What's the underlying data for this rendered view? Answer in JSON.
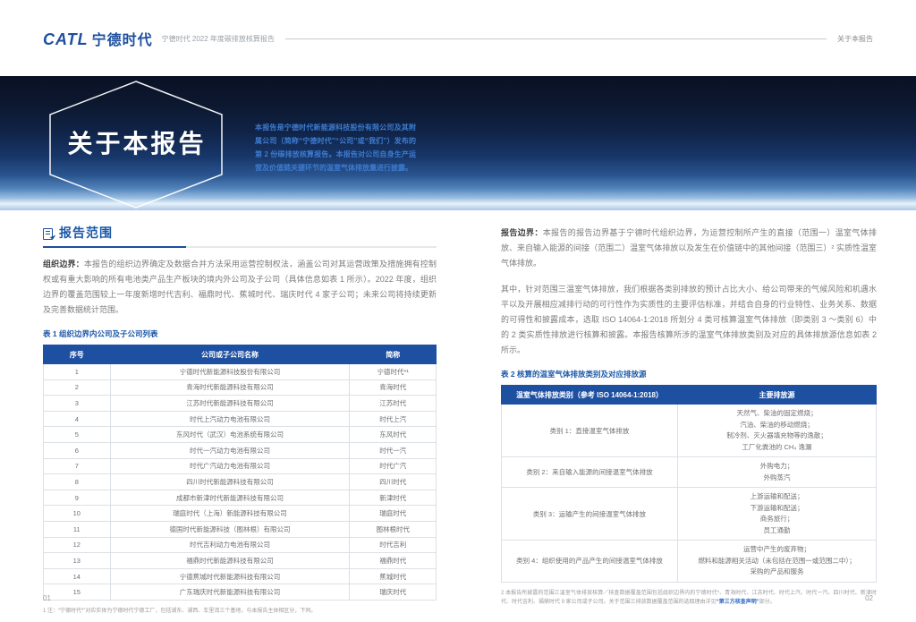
{
  "header": {
    "logo_latin": "CATL",
    "logo_cn": "宁德时代",
    "subtitle": "宁德时代 2022 年度碳排放核算报告",
    "right_label": "关于本报告"
  },
  "hero": {
    "hex_title": "关于本报告",
    "intro": "本报告是宁德时代新能源科技股份有限公司及其附属公司（简称“宁德时代”“公司”或“我们”）发布的第 2 份碳排放核算报告。本报告对公司自身生产运营及价值链关键环节的温室气体排放量进行披露。"
  },
  "left": {
    "section_title": "报告范围",
    "p1_lead": "组织边界：",
    "p1": "本报告的组织边界确定及数据合并方法采用运营控制权法，涵盖公司对其运营政策及措施拥有控制权或有重大影响的所有电池类产品生产板块的境内外公司及子公司（具体信息如表 1 所示）。2022 年度，组织边界的覆盖范围较上一年度新增时代吉利、福鼎时代、蕉城时代、瑞庆时代 4 家子公司；未来公司将持续更新及完善数据统计范围。",
    "table1": {
      "caption": "表 1 组织边界内公司及子公司列表",
      "headers": [
        "序号",
        "公司或子公司名称",
        "简称"
      ],
      "rows": [
        [
          "1",
          "宁德时代新能源科技股份有限公司",
          "宁德时代*¹"
        ],
        [
          "2",
          "青海时代新能源科技有限公司",
          "青海时代"
        ],
        [
          "3",
          "江苏时代新能源科技有限公司",
          "江苏时代"
        ],
        [
          "4",
          "时代上汽动力电池有限公司",
          "时代上汽"
        ],
        [
          "5",
          "东风时代（武汉）电池系统有限公司",
          "东风时代"
        ],
        [
          "6",
          "时代一汽动力电池有限公司",
          "时代一汽"
        ],
        [
          "7",
          "时代广汽动力电池有限公司",
          "时代广汽"
        ],
        [
          "8",
          "四川时代新能源科技有限公司",
          "四川时代"
        ],
        [
          "9",
          "成都市新津时代新能源科技有限公司",
          "新津时代"
        ],
        [
          "10",
          "瑞庭时代（上海）新能源科技有限公司",
          "瑞庭时代"
        ],
        [
          "11",
          "德国时代新能源科技（图林根）有限公司",
          "图林根时代"
        ],
        [
          "12",
          "时代吉利动力电池有限公司",
          "时代吉利"
        ],
        [
          "13",
          "福鼎时代新能源科技有限公司",
          "福鼎时代"
        ],
        [
          "14",
          "宁德蕉城时代新能源科技有限公司",
          "蕉城时代"
        ],
        [
          "15",
          "广东瑞庆时代新能源科技有限公司",
          "瑞庆时代"
        ]
      ],
      "footnote": "1 注：“宁德时代*”对应实体为宁德时代宁德工厂，包括湖东、湖西、车里湾三个基地，与本报告主体相区分，下同。"
    }
  },
  "right": {
    "p1_lead": "报告边界：",
    "p1": "本报告的报告边界基于宁德时代组织边界，为运营控制所产生的直接（范围一）温室气体排放、来自输入能源的间接（范围二）温室气体排放以及发生在价值链中的其他间接（范围三）² 实质性温室气体排放。",
    "p2": "其中，针对范围三温室气体排放，我们根据各类别排放的预计占比大小、给公司带来的气候风险和机遇水平以及开展相应减排行动的可行性作为实质性的主要评估标准，并结合自身的行业特性、业务关系、数据的可得性和披露成本，选取 ISO 14064-1:2018 所划分 4 类可核算温室气体排放（即类别 3 ～类别 6）中的 2 类实质性排放进行核算和披露。本报告核算所涉的温室气体排放类别及对应的具体排放源信息如表 2 所示。",
    "table2": {
      "caption": "表 2 核算的温室气体排放类别及对应排放源",
      "headers": [
        "温室气体排放类别（参考 ISO 14064-1:2018）",
        "主要排放源"
      ],
      "rows": [
        {
          "category": "类别 1：直接温室气体排放",
          "sources": [
            "天然气、柴油的固定燃烧；",
            "汽油、柴油的移动燃烧；",
            "制冷剂、灭火器填充物等的逸散；",
            "工厂化粪池的 CH₄ 逸漏"
          ]
        },
        {
          "category": "类别 2：来自输入能源的间接温室气体排放",
          "sources": [
            "外购电力；",
            "外购蒸汽"
          ]
        },
        {
          "category": "类别 3：运输产生的间接温室气体排放",
          "sources": [
            "上游运输和配送；",
            "下游运输和配送；",
            "商务旅行；",
            "员工通勤"
          ]
        },
        {
          "category": "类别 4：组织使用的产品产生的间接温室气体排放",
          "sources": [
            "运营中产生的废弃物；",
            "燃料和能源相关活动（未包括在范围一或范围二中）；",
            "采购的产品和服务"
          ]
        }
      ]
    },
    "footnote2_prefix": "2 本报告所披露的范围三温室气体排放核算／核查数据覆盖范围包括组织边界内的宁德时代*、青海时代、江苏时代、时代上汽、时代一汽、四川时代、新津时代、时代吉利、福鼎时代 9 家公司或子公司。关于范围三排放数据覆盖范围的选取理由详见",
    "footnote2_link": "“第三方核查声明”",
    "footnote2_suffix": "部分。"
  },
  "footer": {
    "page_left": "01",
    "page_right": "02"
  },
  "colors": {
    "brand_blue": "#1d4f9e",
    "table_header_blue": "#1e50a2",
    "section_title_blue": "#1a57a8",
    "hero_intro_blue": "#3d7bd0"
  }
}
